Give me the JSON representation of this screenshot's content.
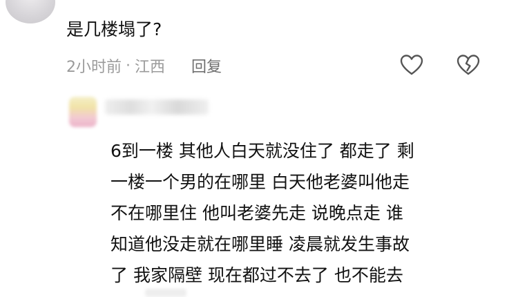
{
  "comment": {
    "text": "是几楼塌了?",
    "time": "2小时前",
    "separator": "·",
    "location": "江西",
    "reply_label": "回复"
  },
  "icons": {
    "like": "heart-outline-icon",
    "dislike": "broken-heart-icon"
  },
  "reply": {
    "lines": [
      "6到一楼 其他人白天就没住了 都走了 剩",
      "一楼一个男的在哪里 白天他老婆叫他走",
      "不在哪里住 他叫老婆先走 说晚点走 谁",
      "知道他没走就在哪里睡 凌晨就发生事故",
      "了 我家隔壁 现在都过不去了 也不能去"
    ]
  },
  "colors": {
    "text": "#111111",
    "meta": "#9a9a9a",
    "icon": "#555555"
  }
}
